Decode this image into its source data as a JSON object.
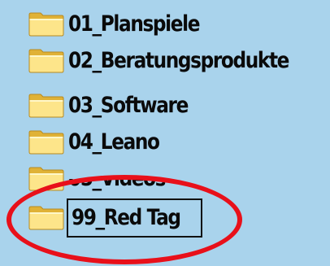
{
  "folders": [
    {
      "name": "01_Planspiele",
      "icon": "folder-icon"
    },
    {
      "name": "02_Beratungsprodukte",
      "icon": "folder-icon"
    },
    {
      "name": "03_Software",
      "icon": "folder-icon"
    },
    {
      "name": "04_Leano",
      "icon": "folder-icon"
    },
    {
      "name": "05_Videos",
      "icon": "folder-icon"
    },
    {
      "name": "99_Red Tag",
      "icon": "folder-icon",
      "state": "renaming"
    }
  ],
  "colors": {
    "background": "#a9d3ec",
    "folder_light": "#fde58a",
    "folder_dark": "#e0b236",
    "highlight": "#e8101a"
  }
}
